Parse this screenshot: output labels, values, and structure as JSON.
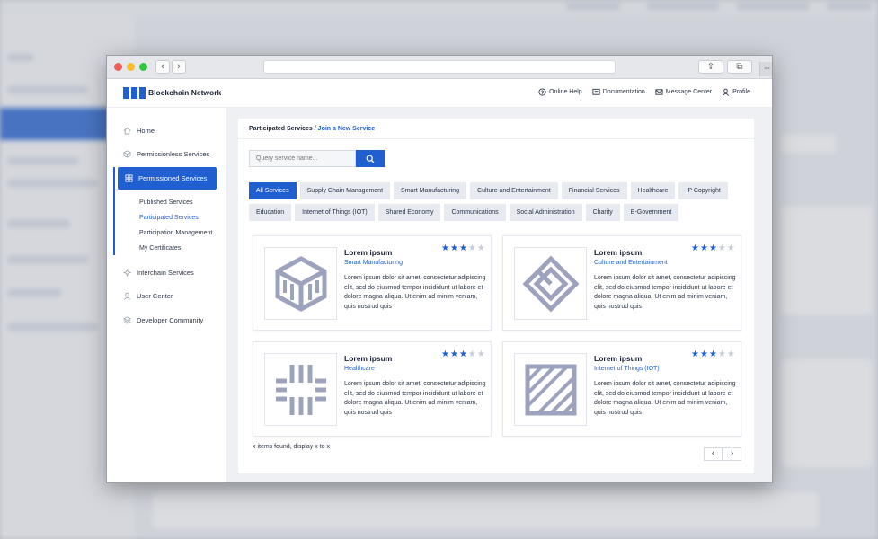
{
  "app": {
    "brand": "Blockchain Network"
  },
  "header": {
    "links": [
      {
        "label": "Online Help",
        "icon": "help-icon"
      },
      {
        "label": "Documentation",
        "icon": "document-icon"
      },
      {
        "label": "Message Center",
        "icon": "mail-icon"
      },
      {
        "label": "Profile",
        "icon": "user-icon"
      }
    ]
  },
  "sidebar": {
    "items": [
      {
        "label": "Home",
        "icon": "home-icon"
      },
      {
        "label": "Permissionless Services",
        "icon": "cube-icon"
      },
      {
        "label": "Permissioned Services",
        "icon": "grid-icon"
      },
      {
        "label": "Interchain Services",
        "icon": "sparkle-icon"
      },
      {
        "label": "User Center",
        "icon": "user-icon"
      },
      {
        "label": "Developer Community",
        "icon": "layers-icon"
      }
    ],
    "subitems": [
      {
        "label": "Published Services"
      },
      {
        "label": "Participated Services"
      },
      {
        "label": "Participation Management"
      },
      {
        "label": "My Certificates"
      }
    ]
  },
  "breadcrumb": {
    "current": "Participated Services",
    "separator": " / ",
    "link": "Join a New Service"
  },
  "search": {
    "placeholder": "Query service name..."
  },
  "categories": [
    "All Services",
    "Supply Chain Management",
    "Smart Manufacturing",
    "Culture and Entertainment",
    "Financial Services",
    "Healthcare",
    "IP Copyright",
    "Education",
    "Internet of Things (IOT)",
    "Shared Economy",
    "Communications",
    "Social Administration",
    "Charity",
    "E-Government"
  ],
  "active_category": "All Services",
  "cards": [
    {
      "title": "Lorem ipsum",
      "category": "Smart Manufacturing",
      "rating": 3,
      "max_rating": 5,
      "description": "Lorem ipsum dolor sit amet, consectetur adipiscing elit, sed do eiusmod tempor incididunt ut labore et dolore magna aliqua. Ut enim ad minim veniam, quis nostrud quis"
    },
    {
      "title": "Lorem ipsum",
      "category": "Culture and Entertainment",
      "rating": 3,
      "max_rating": 5,
      "description": "Lorem ipsum dolor sit amet, consectetur adipiscing elit, sed do eiusmod tempor incididunt ut labore et dolore magna aliqua. Ut enim ad minim veniam, quis nostrud quis"
    },
    {
      "title": "Lorem ipsum",
      "category": "Healthcare",
      "rating": 3,
      "max_rating": 5,
      "description": "Lorem ipsum dolor sit amet, consectetur adipiscing elit, sed do eiusmod tempor incididunt ut labore et dolore magna aliqua. Ut enim ad minim veniam, quis nostrud quis"
    },
    {
      "title": "Lorem ipsum",
      "category": "Internet of Things (IOT)",
      "rating": 3,
      "max_rating": 5,
      "description": "Lorem ipsum dolor sit amet, consectetur adipiscing elit, sed do eiusmod tempor incididunt ut labore et dolore magna aliqua. Ut enim ad minim veniam, quis nostrud quis"
    }
  ],
  "footer": {
    "summary": "x items found, display x to x",
    "prev": "‹",
    "next": "›"
  },
  "browser": {
    "back": "‹",
    "forward": "›",
    "share": "⇪",
    "tabs": "⧉",
    "new_tab": "+"
  },
  "colors": {
    "accent": "#1f5fd0",
    "chip_bg": "#e7eaf0",
    "icon_gray": "#9ea3bd"
  }
}
